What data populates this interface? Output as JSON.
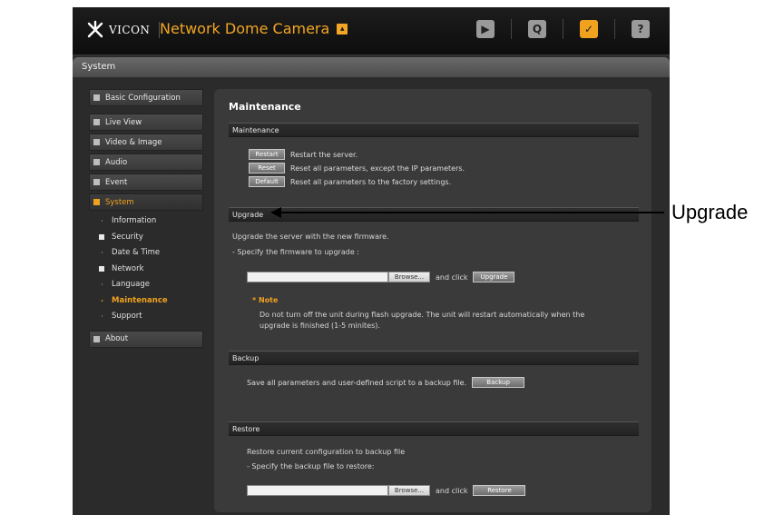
{
  "header": {
    "logo_text": "VICON",
    "app_title": "Network Dome Camera",
    "tools": [
      {
        "icon": "live-view-icon",
        "glyph": "▶"
      },
      {
        "icon": "search-icon",
        "glyph": "Q"
      },
      {
        "icon": "config-icon",
        "glyph": "✓"
      },
      {
        "icon": "help-icon",
        "glyph": "?"
      }
    ]
  },
  "system_bar": {
    "label": "System"
  },
  "sidebar": {
    "items": [
      {
        "label": "Basic Configuration"
      },
      {
        "label": "Live View"
      },
      {
        "label": "Video & Image"
      },
      {
        "label": "Audio"
      },
      {
        "label": "Event"
      },
      {
        "label": "System"
      },
      {
        "label": "About"
      }
    ],
    "system_sub": [
      {
        "label": "Information"
      },
      {
        "label": "Security"
      },
      {
        "label": "Date & Time"
      },
      {
        "label": "Network"
      },
      {
        "label": "Language"
      },
      {
        "label": "Maintenance"
      },
      {
        "label": "Support"
      }
    ]
  },
  "main": {
    "title": "Maintenance",
    "maintenance": {
      "header": "Maintenance",
      "restart_label": "Restart",
      "restart_desc": "Restart the server.",
      "reset_label": "Reset",
      "reset_desc": "Reset all parameters, except the IP parameters.",
      "default_label": "Default",
      "default_desc": "Reset all parameters to the factory settings."
    },
    "upgrade": {
      "header": "Upgrade",
      "line1": "Upgrade the server with the new firmware.",
      "line2": "- Specify the firmware to upgrade :",
      "browse_label": "Browse...",
      "and_click": "and click",
      "upgrade_label": "Upgrade",
      "note_title": "* Note",
      "note_line1": "Do not turn off the unit during flash upgrade. The unit will restart automatically when the",
      "note_line2": "upgrade is finished (1-5 minites)."
    },
    "backup": {
      "header": "Backup",
      "desc": "Save all parameters and user-defined script to a backup file.",
      "backup_label": "Backup"
    },
    "restore": {
      "header": "Restore",
      "line1": "Restore current configuration to backup file",
      "line2": "- Specify the backup file to restore:",
      "browse_label": "Browse...",
      "and_click": "and click",
      "restore_label": "Restore"
    }
  },
  "annotation": {
    "label": "Upgrade"
  },
  "colors": {
    "accent": "#f0a21e",
    "panel": "#3a3a3a",
    "background": "#2b2b2b"
  }
}
